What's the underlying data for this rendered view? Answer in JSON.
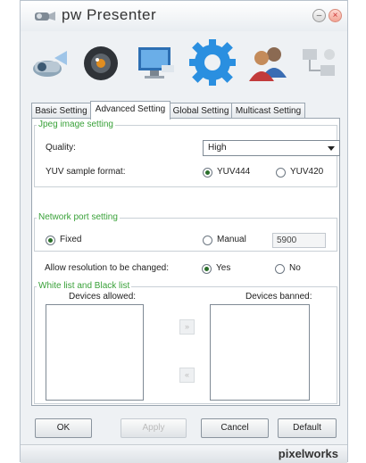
{
  "app": {
    "title": "pw Presenter",
    "brand": "pixelworks"
  },
  "tabs": [
    {
      "label": "Basic Setting"
    },
    {
      "label": "Advanced Setting"
    },
    {
      "label": "Global Setting"
    },
    {
      "label": "Multicast Setting"
    }
  ],
  "jpeg": {
    "group_label": "Jpeg image setting",
    "quality_label": "Quality:",
    "quality_value": "High",
    "yuv_label": "YUV sample format:",
    "yuv444": "YUV444",
    "yuv420": "YUV420",
    "selected": "YUV444"
  },
  "network": {
    "group_label": "Network port setting",
    "fixed": "Fixed",
    "manual": "Manual",
    "port_value": "5900",
    "selected": "Fixed"
  },
  "resolution": {
    "label": "Allow resolution to be changed:",
    "yes": "Yes",
    "no": "No",
    "selected": "Yes"
  },
  "lists": {
    "group_label": "White list and Black list",
    "allowed_label": "Devices allowed:",
    "banned_label": "Devices banned:",
    "add_symbol": "»",
    "remove_symbol": "«"
  },
  "buttons": {
    "ok": "OK",
    "apply": "Apply",
    "cancel": "Cancel",
    "default": "Default"
  },
  "icons": [
    "projector-icon",
    "webcam-icon",
    "monitor-icon",
    "gear-icon",
    "users-icon",
    "network-icon"
  ]
}
